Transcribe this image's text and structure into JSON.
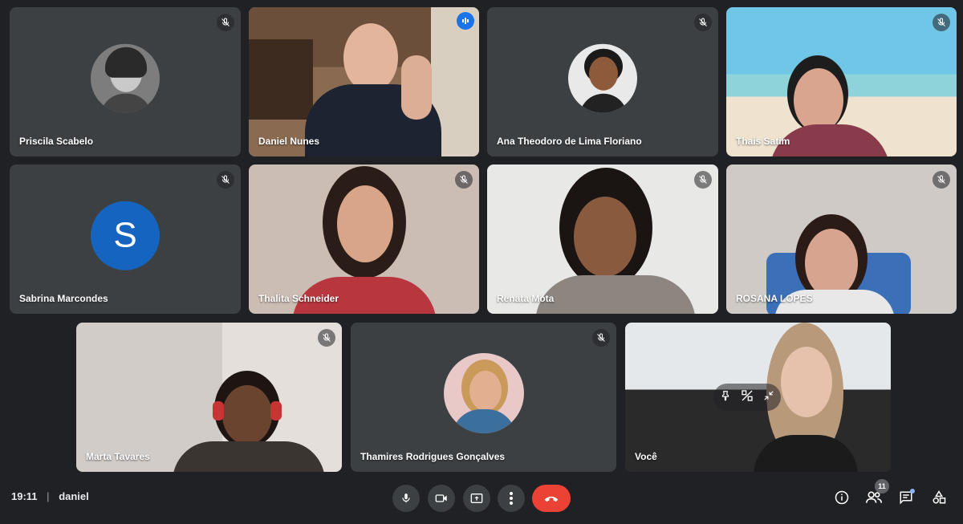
{
  "participants": [
    {
      "name": "Priscila Scabelo"
    },
    {
      "name": "Daniel Nunes"
    },
    {
      "name": "Ana Theodoro de Lima Floriano"
    },
    {
      "name": "Thais Satim"
    },
    {
      "name": "Sabrina Marcondes",
      "avatar_letter": "S"
    },
    {
      "name": "Thalita Schneider"
    },
    {
      "name": "Renata Mota"
    },
    {
      "name": "ROSANA LOPES"
    },
    {
      "name": "Marta Tavares"
    },
    {
      "name": "Thamires Rodrigues Gonçalves"
    },
    {
      "name": "Você"
    }
  ],
  "bottom_bar": {
    "time": "19:11",
    "separator": "|",
    "meeting_name": "daniel",
    "participant_count": "11"
  },
  "colors": {
    "background": "#202124",
    "tile": "#3c4043",
    "active_speaker": "#8ab4f8",
    "hangup": "#ea4335",
    "avatar_letter_bg": "#1565c0"
  }
}
